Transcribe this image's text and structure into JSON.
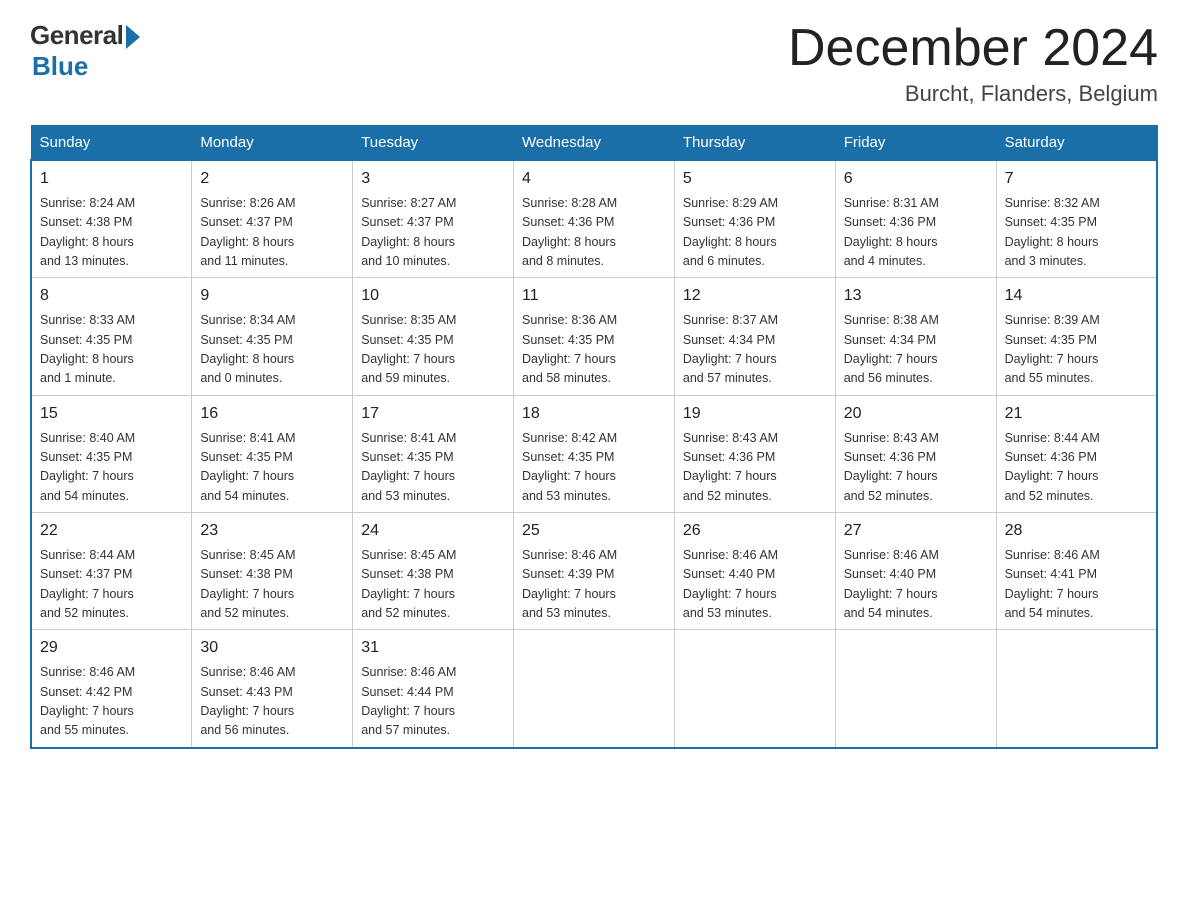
{
  "header": {
    "logo_general": "General",
    "logo_blue": "Blue",
    "month_title": "December 2024",
    "location": "Burcht, Flanders, Belgium"
  },
  "days_of_week": [
    "Sunday",
    "Monday",
    "Tuesday",
    "Wednesday",
    "Thursday",
    "Friday",
    "Saturday"
  ],
  "weeks": [
    [
      {
        "num": "1",
        "info": "Sunrise: 8:24 AM\nSunset: 4:38 PM\nDaylight: 8 hours\nand 13 minutes."
      },
      {
        "num": "2",
        "info": "Sunrise: 8:26 AM\nSunset: 4:37 PM\nDaylight: 8 hours\nand 11 minutes."
      },
      {
        "num": "3",
        "info": "Sunrise: 8:27 AM\nSunset: 4:37 PM\nDaylight: 8 hours\nand 10 minutes."
      },
      {
        "num": "4",
        "info": "Sunrise: 8:28 AM\nSunset: 4:36 PM\nDaylight: 8 hours\nand 8 minutes."
      },
      {
        "num": "5",
        "info": "Sunrise: 8:29 AM\nSunset: 4:36 PM\nDaylight: 8 hours\nand 6 minutes."
      },
      {
        "num": "6",
        "info": "Sunrise: 8:31 AM\nSunset: 4:36 PM\nDaylight: 8 hours\nand 4 minutes."
      },
      {
        "num": "7",
        "info": "Sunrise: 8:32 AM\nSunset: 4:35 PM\nDaylight: 8 hours\nand 3 minutes."
      }
    ],
    [
      {
        "num": "8",
        "info": "Sunrise: 8:33 AM\nSunset: 4:35 PM\nDaylight: 8 hours\nand 1 minute."
      },
      {
        "num": "9",
        "info": "Sunrise: 8:34 AM\nSunset: 4:35 PM\nDaylight: 8 hours\nand 0 minutes."
      },
      {
        "num": "10",
        "info": "Sunrise: 8:35 AM\nSunset: 4:35 PM\nDaylight: 7 hours\nand 59 minutes."
      },
      {
        "num": "11",
        "info": "Sunrise: 8:36 AM\nSunset: 4:35 PM\nDaylight: 7 hours\nand 58 minutes."
      },
      {
        "num": "12",
        "info": "Sunrise: 8:37 AM\nSunset: 4:34 PM\nDaylight: 7 hours\nand 57 minutes."
      },
      {
        "num": "13",
        "info": "Sunrise: 8:38 AM\nSunset: 4:34 PM\nDaylight: 7 hours\nand 56 minutes."
      },
      {
        "num": "14",
        "info": "Sunrise: 8:39 AM\nSunset: 4:35 PM\nDaylight: 7 hours\nand 55 minutes."
      }
    ],
    [
      {
        "num": "15",
        "info": "Sunrise: 8:40 AM\nSunset: 4:35 PM\nDaylight: 7 hours\nand 54 minutes."
      },
      {
        "num": "16",
        "info": "Sunrise: 8:41 AM\nSunset: 4:35 PM\nDaylight: 7 hours\nand 54 minutes."
      },
      {
        "num": "17",
        "info": "Sunrise: 8:41 AM\nSunset: 4:35 PM\nDaylight: 7 hours\nand 53 minutes."
      },
      {
        "num": "18",
        "info": "Sunrise: 8:42 AM\nSunset: 4:35 PM\nDaylight: 7 hours\nand 53 minutes."
      },
      {
        "num": "19",
        "info": "Sunrise: 8:43 AM\nSunset: 4:36 PM\nDaylight: 7 hours\nand 52 minutes."
      },
      {
        "num": "20",
        "info": "Sunrise: 8:43 AM\nSunset: 4:36 PM\nDaylight: 7 hours\nand 52 minutes."
      },
      {
        "num": "21",
        "info": "Sunrise: 8:44 AM\nSunset: 4:36 PM\nDaylight: 7 hours\nand 52 minutes."
      }
    ],
    [
      {
        "num": "22",
        "info": "Sunrise: 8:44 AM\nSunset: 4:37 PM\nDaylight: 7 hours\nand 52 minutes."
      },
      {
        "num": "23",
        "info": "Sunrise: 8:45 AM\nSunset: 4:38 PM\nDaylight: 7 hours\nand 52 minutes."
      },
      {
        "num": "24",
        "info": "Sunrise: 8:45 AM\nSunset: 4:38 PM\nDaylight: 7 hours\nand 52 minutes."
      },
      {
        "num": "25",
        "info": "Sunrise: 8:46 AM\nSunset: 4:39 PM\nDaylight: 7 hours\nand 53 minutes."
      },
      {
        "num": "26",
        "info": "Sunrise: 8:46 AM\nSunset: 4:40 PM\nDaylight: 7 hours\nand 53 minutes."
      },
      {
        "num": "27",
        "info": "Sunrise: 8:46 AM\nSunset: 4:40 PM\nDaylight: 7 hours\nand 54 minutes."
      },
      {
        "num": "28",
        "info": "Sunrise: 8:46 AM\nSunset: 4:41 PM\nDaylight: 7 hours\nand 54 minutes."
      }
    ],
    [
      {
        "num": "29",
        "info": "Sunrise: 8:46 AM\nSunset: 4:42 PM\nDaylight: 7 hours\nand 55 minutes."
      },
      {
        "num": "30",
        "info": "Sunrise: 8:46 AM\nSunset: 4:43 PM\nDaylight: 7 hours\nand 56 minutes."
      },
      {
        "num": "31",
        "info": "Sunrise: 8:46 AM\nSunset: 4:44 PM\nDaylight: 7 hours\nand 57 minutes."
      },
      null,
      null,
      null,
      null
    ]
  ]
}
